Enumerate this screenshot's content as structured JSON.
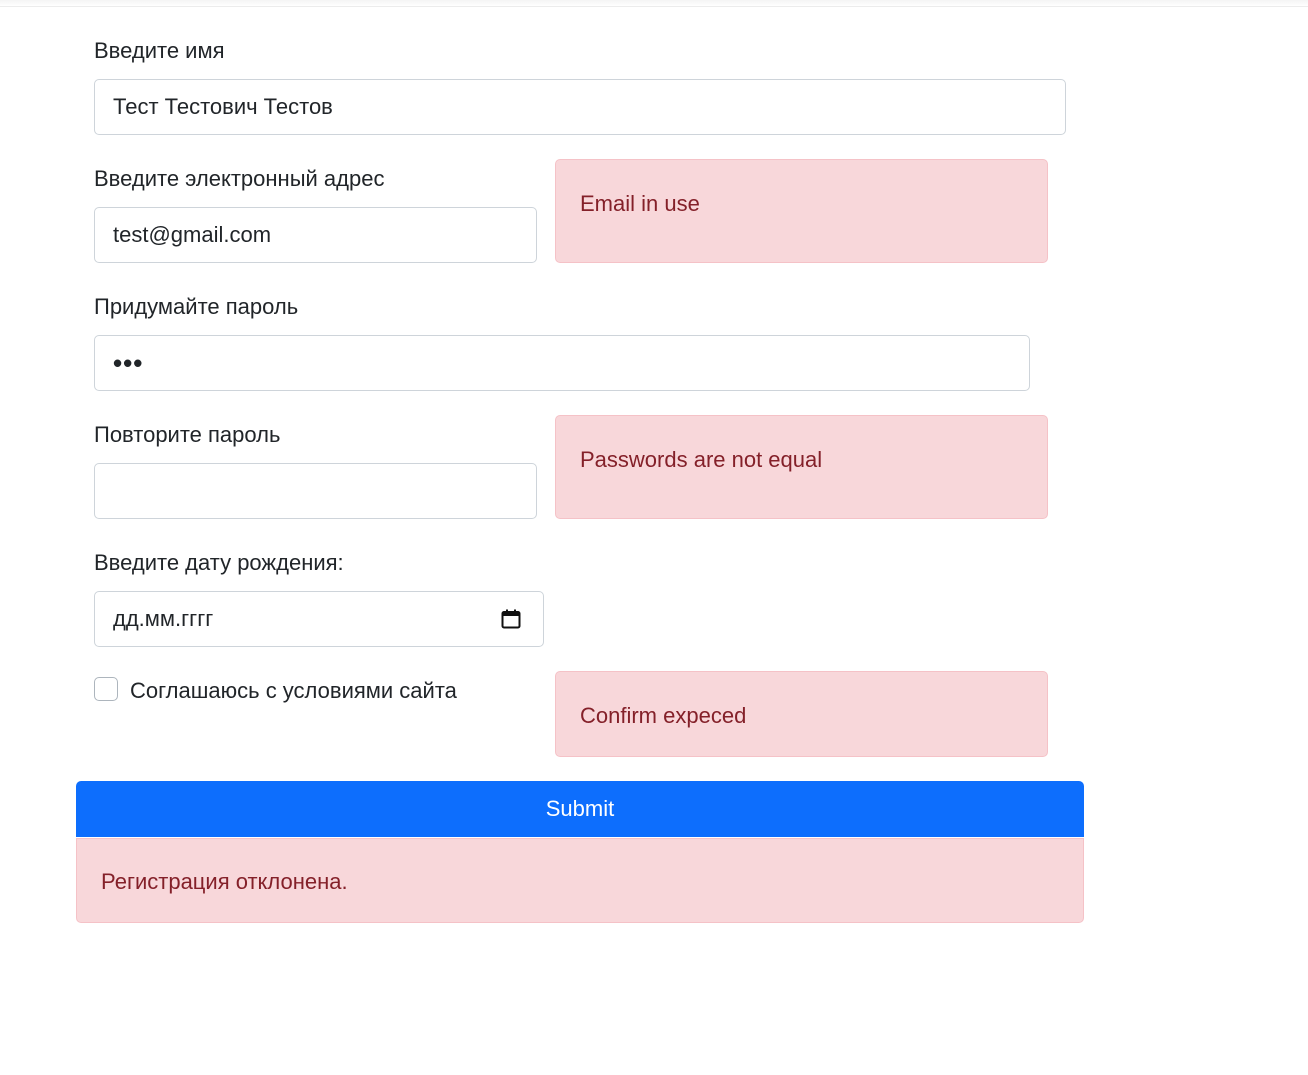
{
  "form": {
    "name": {
      "label": "Введите имя",
      "value": "Тест Тестович Тестов"
    },
    "email": {
      "label": "Введите электронный адрес",
      "value": "test@gmail.com",
      "error": "Email in use"
    },
    "password": {
      "label": "Придумайте пароль",
      "value": "•••"
    },
    "password_repeat": {
      "label": "Повторите пароль",
      "value": "",
      "error": "Passwords are not equal"
    },
    "birthdate": {
      "label": "Введите дату рождения:",
      "placeholder": "дд.мм.гггг",
      "icon": "calendar-icon"
    },
    "terms": {
      "label": "Соглашаюсь с условиями сайта",
      "checked": false,
      "error": "Confirm expeced"
    },
    "submit_label": "Submit",
    "result_message": "Регистрация отклонена."
  },
  "colors": {
    "primary": "#0d6efd",
    "alert_bg": "#f8d7da",
    "alert_border": "#f5c2c7",
    "alert_text": "#842029",
    "input_border": "#ced4da"
  }
}
